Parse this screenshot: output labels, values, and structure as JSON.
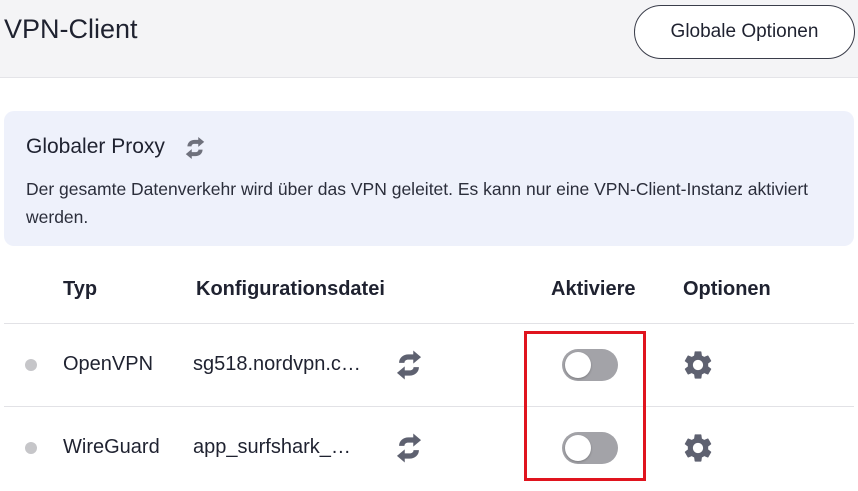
{
  "header": {
    "title": "VPN-Client",
    "global_options_label": "Globale Optionen"
  },
  "global_proxy": {
    "title": "Globaler Proxy",
    "icon": "sync-icon",
    "description": "Der gesamte Datenverkehr wird über das VPN geleitet. Es kann nur eine VPN-Client-Instanz aktiviert werden."
  },
  "table": {
    "columns": [
      "Typ",
      "Konfigurationsdatei",
      "Aktiviere",
      "Optionen"
    ],
    "rows": [
      {
        "type": "OpenVPN",
        "config_file": "sg518.nordvpn.c…",
        "active": false
      },
      {
        "type": "WireGuard",
        "config_file": "app_surfshark_…",
        "active": false
      }
    ]
  },
  "colors": {
    "accent_border": "#3a3d4a",
    "info_background": "#eef1fb",
    "toggle_off": "#a3a3a8",
    "highlight": "#e0141e",
    "status_dot": "#c6c6c9"
  }
}
